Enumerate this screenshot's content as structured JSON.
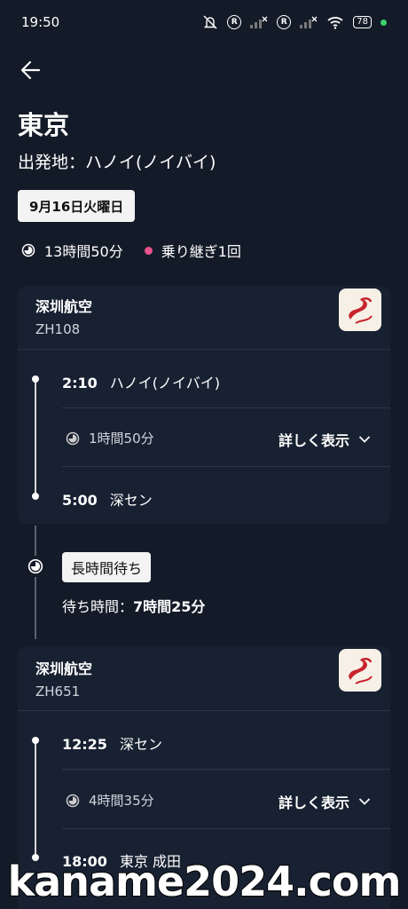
{
  "status": {
    "time": "19:50",
    "battery": "78"
  },
  "header": {
    "title": "東京",
    "origin": "出発地：ハノイ(ノイバイ)"
  },
  "date": "9月16日火曜日",
  "summary": {
    "total": "13時間50分",
    "transfers": "乗り継ぎ1回"
  },
  "legs": [
    {
      "airline": "深圳航空",
      "flight": "ZH108",
      "depart_time": "2:10",
      "depart_place": "ハノイ(ノイバイ)",
      "duration": "1時間50分",
      "details_label": "詳しく表示",
      "arrive_time": "5:00",
      "arrive_place": "深セン"
    },
    {
      "airline": "深圳航空",
      "flight": "ZH651",
      "depart_time": "12:25",
      "depart_place": "深セン",
      "duration": "4時間35分",
      "details_label": "詳しく表示",
      "arrive_time": "18:00",
      "arrive_place": "東京 成田"
    }
  ],
  "layover": {
    "badge": "長時間待ち",
    "label": "待ち時間：",
    "value": "7時間25分"
  },
  "watermark": "kaname2024.com",
  "colors": {
    "background": "#141b28",
    "card": "#182131",
    "accent_dot": "#e8558d"
  }
}
